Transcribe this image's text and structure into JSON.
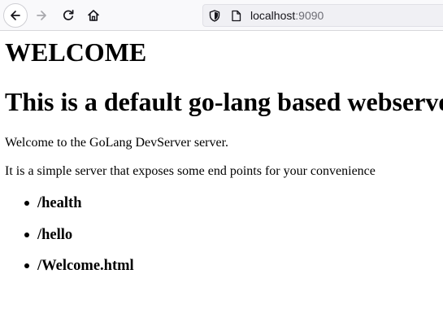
{
  "browser": {
    "url_host": "localhost",
    "url_port": ":9090",
    "toolbar_icons": [
      "back-arrow-icon",
      "forward-arrow-icon",
      "reload-icon",
      "home-icon",
      "shield-icon",
      "page-icon"
    ],
    "accent_color": "#15141a"
  },
  "page": {
    "heading_welcome": "WELCOME",
    "heading_default": "This is a default go-lang based webserver",
    "paragraph_welcome": "Welcome to the GoLang DevServer server.",
    "paragraph_description": "It is a simple server that exposes some end points for your convenience",
    "endpoints": [
      "/health",
      "/hello",
      "/Welcome.html"
    ]
  }
}
